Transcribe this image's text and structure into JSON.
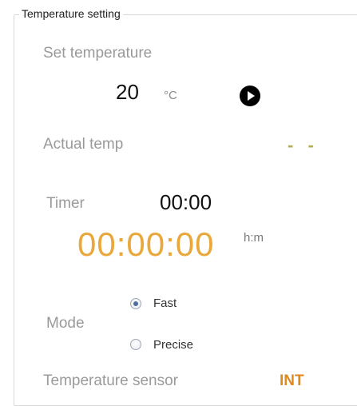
{
  "group": {
    "title": "Temperature setting"
  },
  "set_temperature": {
    "label": "Set temperature",
    "value": "20",
    "unit": "°C",
    "start_icon": "play-icon"
  },
  "actual_temp": {
    "label": "Actual temp",
    "value": "- -"
  },
  "timer": {
    "label": "Timer",
    "value": "00:00",
    "elapsed": "00:00:00",
    "unit": "h:m"
  },
  "mode": {
    "label": "Mode",
    "options": [
      {
        "label": "Fast",
        "selected": true
      },
      {
        "label": "Precise",
        "selected": false
      }
    ]
  },
  "sensor": {
    "label": "Temperature sensor",
    "value": "INT"
  },
  "colors": {
    "accent_orange": "#e9a83b",
    "sensor_orange": "#e08a1e",
    "actual_value": "#b7ad4c",
    "label_grey": "#9a9a9a"
  }
}
